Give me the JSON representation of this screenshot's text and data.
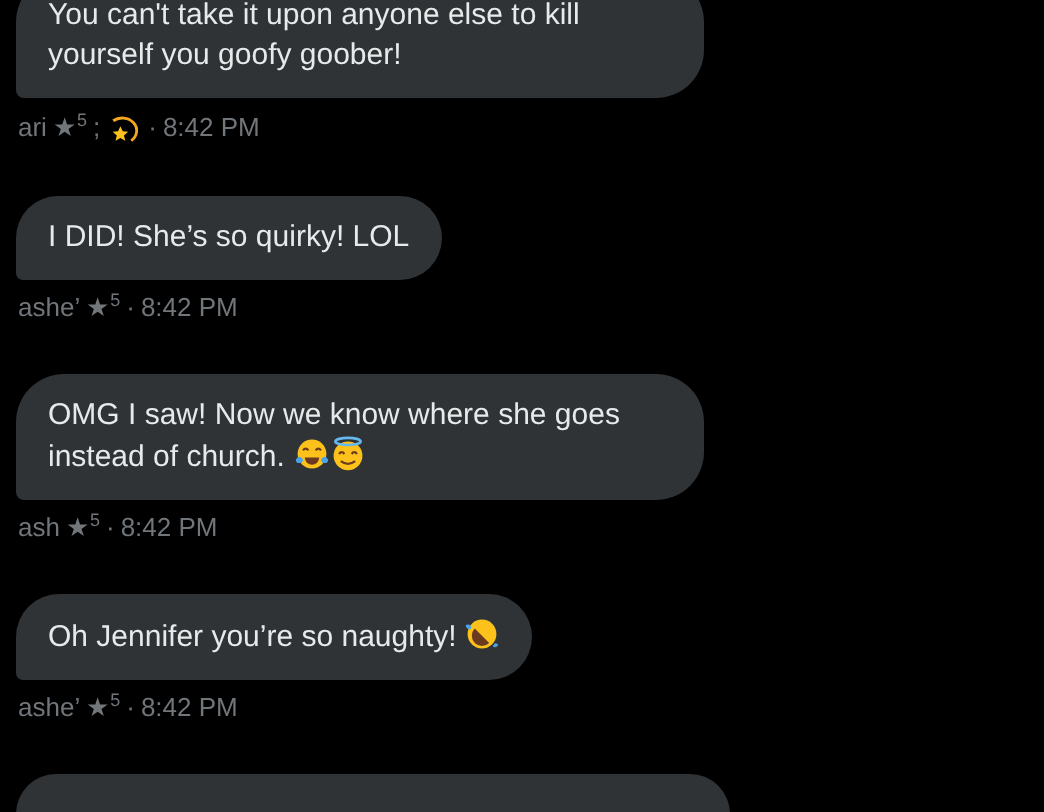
{
  "messages": [
    {
      "kind": "message",
      "text": "You can't take it upon anyone else to kill yourself you goofy goober!",
      "meta": {
        "name": "ari",
        "star": "★",
        "rank": "5",
        "extra": {
          "separator": ";",
          "kind": "dizzy"
        },
        "dot": "·",
        "time": "8:42 PM"
      }
    },
    {
      "kind": "message",
      "text": "I DID! She’s so quirky! LOL",
      "meta": {
        "name": "ashe’",
        "star": "★",
        "rank": "5",
        "dot": "·",
        "time": "8:42 PM"
      }
    },
    {
      "kind": "message",
      "text": "OMG I saw! Now we know where she goes instead of church.",
      "emojis": [
        {
          "kind": "joy"
        },
        {
          "kind": "halo"
        }
      ],
      "meta": {
        "name": "ash",
        "star": "★",
        "rank": "5",
        "dot": "·",
        "time": "8:42 PM"
      }
    },
    {
      "kind": "message",
      "text": "Oh Jennifer you’re so naughty!",
      "emojis": [
        {
          "kind": "rofl"
        }
      ],
      "meta": {
        "name": "ashe’",
        "star": "★",
        "rank": "5",
        "dot": "·",
        "time": "8:42 PM"
      }
    },
    {
      "kind": "partial"
    }
  ]
}
